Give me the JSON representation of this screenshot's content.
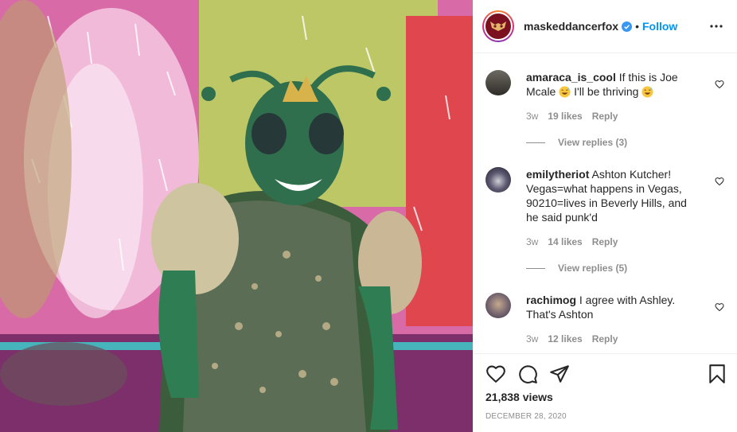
{
  "post": {
    "username": "maskeddancerfox",
    "follow_label": "Follow",
    "separator": "•",
    "views": "21,838 views",
    "date": "DECEMBER 28, 2020"
  },
  "media": {
    "description_icon": "video-frame"
  },
  "comments": [
    {
      "username": "amaraca_is_cool",
      "text_before": "If this is Joe Mcale",
      "emoji_1": "grinning-sweat-emoji",
      "text_middle": "I'll be thriving",
      "emoji_2": "grinning-sweat-emoji",
      "time": "3w",
      "likes": "19 likes",
      "reply": "Reply",
      "view_replies": "View replies (3)"
    },
    {
      "username": "emilytheriot",
      "text": "Ashton Kutcher! Vegas=what happens in Vegas, 90210=lives in Beverly Hills, and he said punk'd",
      "time": "3w",
      "likes": "14 likes",
      "reply": "Reply",
      "view_replies": "View replies (5)"
    },
    {
      "username": "rachimog",
      "text": "I agree with Ashley. That's Ashton",
      "time": "3w",
      "likes": "12 likes",
      "reply": "Reply"
    }
  ],
  "colors": {
    "accent": "#0095f6",
    "verified": "#3897f0",
    "muted": "#8e8e8e",
    "text": "#262626"
  }
}
